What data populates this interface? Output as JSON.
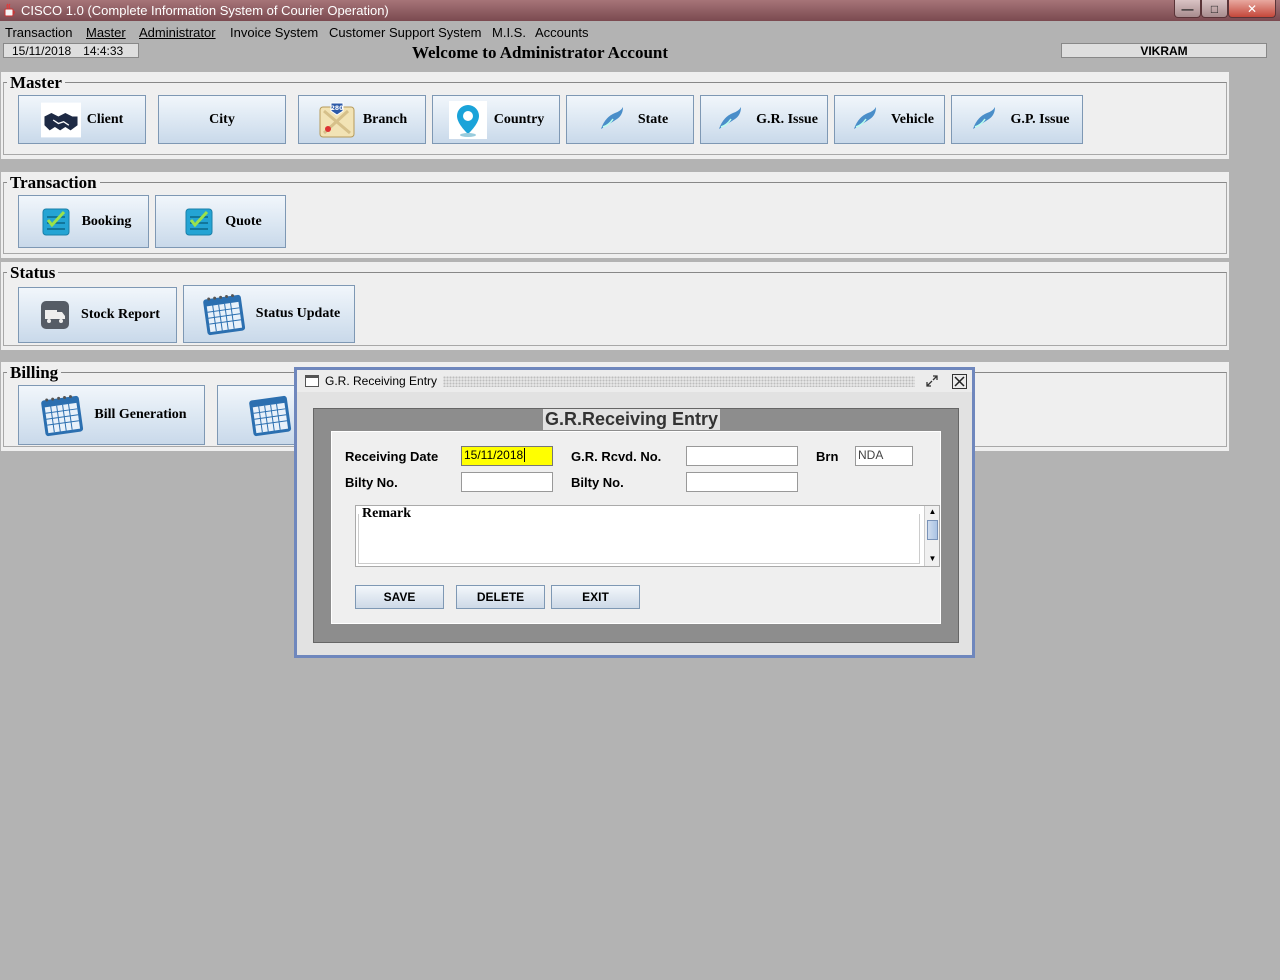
{
  "window": {
    "title": "CISCO 1.0 (Complete Information System of Courier Operation)",
    "controls": {
      "minimize": "—",
      "maximize": "□",
      "close": "✕"
    }
  },
  "menu": [
    "Transaction",
    "Master",
    "Administrator",
    "Invoice System",
    "Customer Support System",
    "M.I.S.",
    "Accounts"
  ],
  "status": {
    "date": "15/11/2018",
    "time": "14:4:33",
    "welcome": "Welcome to Administrator Account",
    "user": "VIKRAM"
  },
  "panels": {
    "master": {
      "title": "Master",
      "buttons": [
        "Client",
        "City",
        "Branch",
        "Country",
        "State",
        "G.R. Issue",
        "Vehicle",
        "G.P. Issue"
      ]
    },
    "transaction": {
      "title": "Transaction",
      "buttons": [
        "Booking",
        "Quote"
      ]
    },
    "status": {
      "title": "Status",
      "buttons": [
        "Stock Report",
        "Status Update"
      ]
    },
    "billing": {
      "title": "Billing",
      "buttons": [
        "Bill Generation"
      ]
    }
  },
  "dialog": {
    "window_title": "G.R. Receiving Entry",
    "heading": "G.R.Receiving Entry",
    "fields": {
      "receiving_date_label": "Receiving Date",
      "receiving_date_value": "15/11/2018",
      "gr_rcvd_no_label": "G.R. Rcvd. No.",
      "gr_rcvd_no_value": "",
      "brn_label": "Brn",
      "brn_value": "NDA",
      "bilty_no_label_1": "Bilty No.",
      "bilty_no_value_1": "",
      "bilty_no_label_2": "Bilty No.",
      "bilty_no_value_2": ""
    },
    "remark_label": "Remark",
    "buttons": {
      "save": "SAVE",
      "delete": "DELETE",
      "exit": "EXIT"
    },
    "highlight_color": "#ffff00"
  },
  "icons": {
    "client": "handshake-icon",
    "branch": "map-icon",
    "country": "location-pin-icon",
    "state": "bird-icon",
    "booking": "checklist-icon",
    "stock_report": "truck-icon",
    "status_update": "calendar-icon",
    "bill_generation": "calendar-icon"
  }
}
